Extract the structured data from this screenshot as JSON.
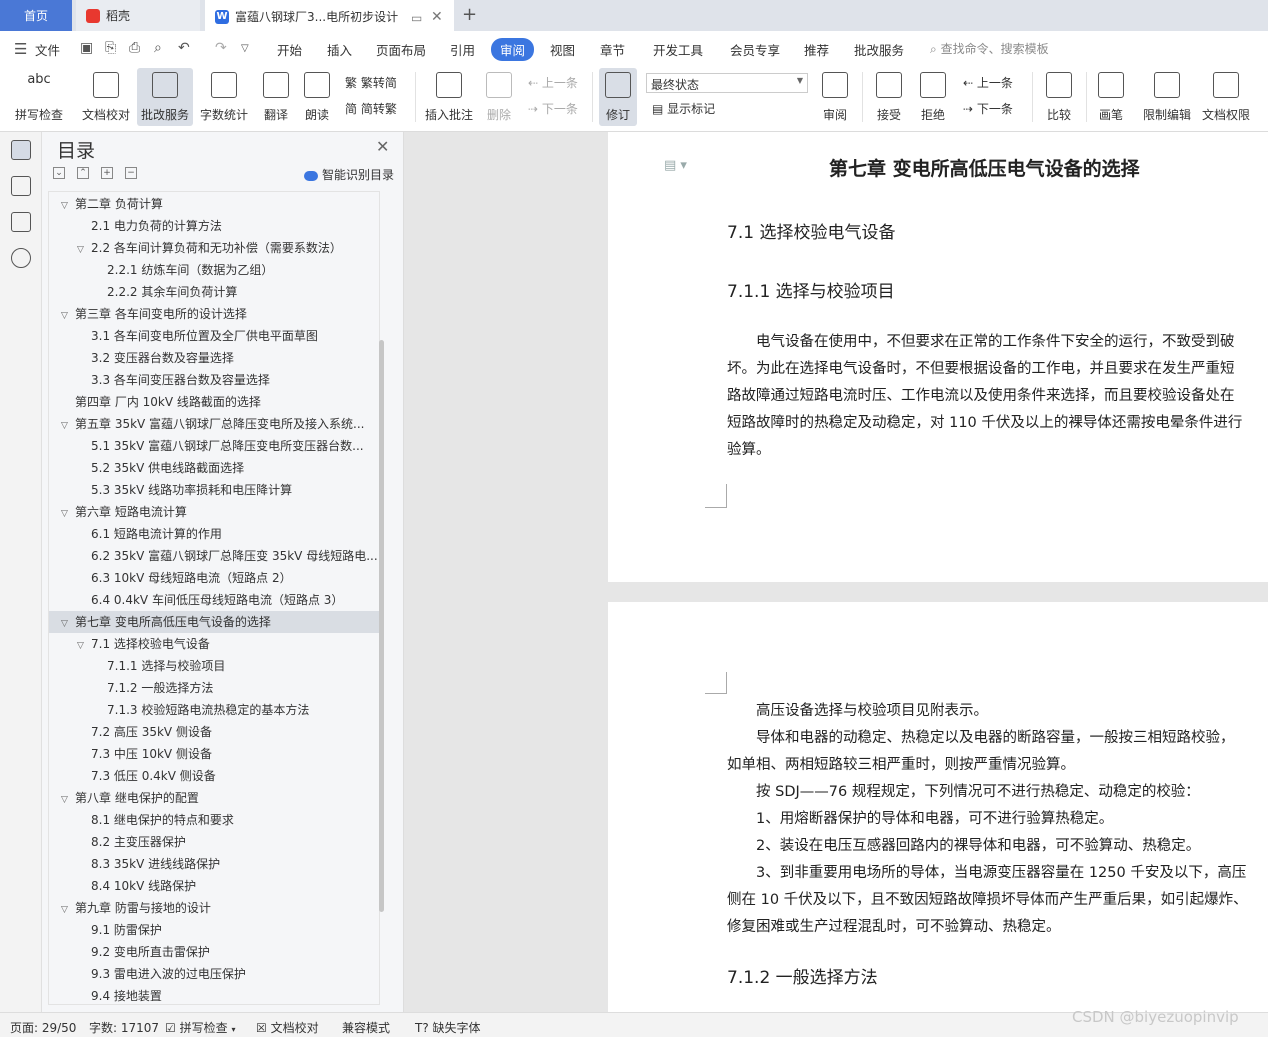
{
  "tabs": {
    "home": "首页",
    "daoke": "稻壳",
    "doc": "富蕴八钢球厂3...电所初步设计",
    "add": "+"
  },
  "menu": {
    "file": "文件",
    "items": [
      "开始",
      "插入",
      "页面布局",
      "引用",
      "审阅",
      "视图",
      "章节",
      "开发工具",
      "会员专享",
      "推荐",
      "批改服务"
    ],
    "active": "审阅",
    "search_placeholder": "查找命令、搜索模板"
  },
  "ribbon": {
    "spell_check": "拼写检查",
    "doc_check": "文档校对",
    "review_service": "批改服务",
    "word_count": "字数统计",
    "translate": "翻译",
    "read_aloud": "朗读",
    "trad_to_simp": "繁转简",
    "simp_to_trad": "简转繁",
    "insert_comment": "插入批注",
    "delete": "删除",
    "prev_comment": "上一条",
    "next_comment": "下一条",
    "track_changes": "修订",
    "state_value": "最终状态",
    "show_markup": "显示标记",
    "review_pane": "审阅",
    "accept": "接受",
    "reject": "拒绝",
    "prev_change": "上一条",
    "next_change": "下一条",
    "compare": "比较",
    "pen": "画笔",
    "restrict_edit": "限制编辑",
    "doc_permission": "文档权限"
  },
  "toc": {
    "title": "目录",
    "smart": "智能识别目录",
    "items": [
      {
        "level": 1,
        "arrow": "open",
        "text": "第二章  负荷计算"
      },
      {
        "level": 2,
        "arrow": "none",
        "text": "2.1 电力负荷的计算方法"
      },
      {
        "level": 2,
        "arrow": "open",
        "text": "2.2  各车间计算负荷和无功补偿（需要系数法）"
      },
      {
        "level": 3,
        "arrow": "none",
        "text": "2.2.1  纺炼车间（数据为乙组）"
      },
      {
        "level": 3,
        "arrow": "none",
        "text": "2.2.2  其余车间负荷计算"
      },
      {
        "level": 1,
        "arrow": "open",
        "text": "第三章  各车间变电所的设计选择"
      },
      {
        "level": 2,
        "arrow": "none",
        "text": "3.1  各车间变电所位置及全厂供电平面草图"
      },
      {
        "level": 2,
        "arrow": "none",
        "text": "3.2  变压器台数及容量选择"
      },
      {
        "level": 2,
        "arrow": "none",
        "text": "3.3  各车间变压器台数及容量选择"
      },
      {
        "level": 1,
        "arrow": "none",
        "text": "第四章  厂内 10kV 线路截面的选择"
      },
      {
        "level": 1,
        "arrow": "open",
        "text": "第五章  35kV 富蕴八钢球厂总降压变电所及接入系统..."
      },
      {
        "level": 2,
        "arrow": "none",
        "text": "5.1 35kV 富蕴八钢球厂总降压变电所变压器台数..."
      },
      {
        "level": 2,
        "arrow": "none",
        "text": "5.2 35kV 供电线路截面选择"
      },
      {
        "level": 2,
        "arrow": "none",
        "text": "5.3 35kV 线路功率损耗和电压降计算"
      },
      {
        "level": 1,
        "arrow": "open",
        "text": "第六章  短路电流计算"
      },
      {
        "level": 2,
        "arrow": "none",
        "text": "6.1 短路电流计算的作用"
      },
      {
        "level": 2,
        "arrow": "none",
        "text": "6.2 35kV 富蕴八钢球厂总降压变 35kV 母线短路电..."
      },
      {
        "level": 2,
        "arrow": "none",
        "text": "6.3 10kV 母线短路电流（短路点 2）"
      },
      {
        "level": 2,
        "arrow": "none",
        "text": "6.4 0.4kV 车间低压母线短路电流（短路点 3）"
      },
      {
        "level": 1,
        "arrow": "open",
        "text": "第七章  变电所高低压电气设备的选择",
        "selected": true
      },
      {
        "level": 2,
        "arrow": "open",
        "text": "7.1 选择校验电气设备"
      },
      {
        "level": 3,
        "arrow": "none",
        "text": "7.1.1  选择与校验项目"
      },
      {
        "level": 3,
        "arrow": "none",
        "text": "7.1.2 一般选择方法"
      },
      {
        "level": 3,
        "arrow": "none",
        "text": "7.1.3 校验短路电流热稳定的基本方法"
      },
      {
        "level": 2,
        "arrow": "none",
        "text": "7.2  高压 35kV 侧设备"
      },
      {
        "level": 2,
        "arrow": "none",
        "text": "7.3  中压 10kV 侧设备"
      },
      {
        "level": 2,
        "arrow": "none",
        "text": "7.3  低压 0.4kV 侧设备"
      },
      {
        "level": 1,
        "arrow": "open",
        "text": "第八章  继电保护的配置"
      },
      {
        "level": 2,
        "arrow": "none",
        "text": "8.1 继电保护的特点和要求"
      },
      {
        "level": 2,
        "arrow": "none",
        "text": "8.2 主变压器保护"
      },
      {
        "level": 2,
        "arrow": "none",
        "text": "8.3 35kV 进线线路保护"
      },
      {
        "level": 2,
        "arrow": "none",
        "text": "8.4 10kV 线路保护"
      },
      {
        "level": 1,
        "arrow": "open",
        "text": "第九章  防雷与接地的设计"
      },
      {
        "level": 2,
        "arrow": "none",
        "text": "9.1  防雷保护"
      },
      {
        "level": 2,
        "arrow": "none",
        "text": "9.2  变电所直击雷保护"
      },
      {
        "level": 2,
        "arrow": "none",
        "text": "9.3  雷电进入波的过电压保护"
      },
      {
        "level": 2,
        "arrow": "none",
        "text": "9.4  接地装置"
      }
    ]
  },
  "doc": {
    "chapter_title": "第七章  变电所高低压电气设备的选择",
    "sec_71": "7.1 选择校验电气设备",
    "sec_711": "7.1.1  选择与校验项目",
    "para1": [
      "　　电气设备在使用中，不但要求在正常的工作条件下安全的运行，不致受到破",
      "坏。为此在选择电气设备时，不但要根据设备的工作电，并且要求在发生严重短",
      "路故障通过短路电流时压、工作电流以及使用条件来选择，而且要校验设备处在",
      "短路故障时的热稳定及动稳定，对 110 千伏及以上的裸导体还需按电晕条件进行",
      "验算。"
    ],
    "para2": [
      "　　高压设备选择与校验项目见附表示。",
      "　　导体和电器的动稳定、热稳定以及电器的断路容量，一般按三相短路校验，",
      "如单相、两相短路较三相严重时，则按严重情况验算。",
      "　　按 SDJ——76 规程规定，下列情况可不进行热稳定、动稳定的校验：",
      "　　1、用熔断器保护的导体和电器，可不进行验算热稳定。",
      "　　2、装设在电压互感器回路内的裸导体和电器，可不验算动、热稳定。",
      "　　3、到非重要用电场所的导体，当电源变压器容量在 1250 千安及以下，高压",
      "侧在 10 千伏及以下，且不致因短路故障损坏导体而产生严重后果，如引起爆炸、",
      "修复困难或生产过程混乱时，可不验算动、热稳定。"
    ],
    "sec_712": "7.1.2 一般选择方法"
  },
  "status": {
    "page": "页面: 29/50",
    "words": "字数: 17107",
    "spell": "拼写检查",
    "proof": "文档校对",
    "compat": "兼容模式",
    "missing_font": "缺失字体"
  },
  "watermark": "CSDN @biyezuopinvip"
}
